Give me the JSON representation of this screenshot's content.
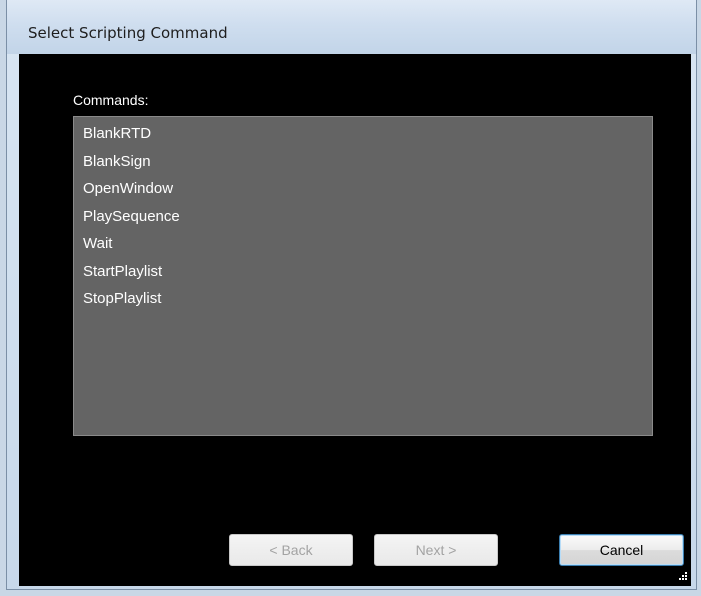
{
  "window": {
    "title": "Select Scripting Command"
  },
  "commands": {
    "label": "Commands:",
    "items": [
      "BlankRTD",
      "BlankSign",
      "OpenWindow",
      "PlaySequence",
      "Wait",
      "StartPlaylist",
      "StopPlaylist"
    ]
  },
  "buttons": {
    "back_label": "< Back",
    "next_label": "Next >",
    "cancel_label": "Cancel"
  },
  "icons": {
    "grip": "resize-grip-icon"
  },
  "colors": {
    "client_background": "#000000",
    "listbox_background": "#646464",
    "list_text": "#ffffff",
    "disabled_text": "#a3a3a3",
    "default_button_border": "#3c7fb1"
  }
}
